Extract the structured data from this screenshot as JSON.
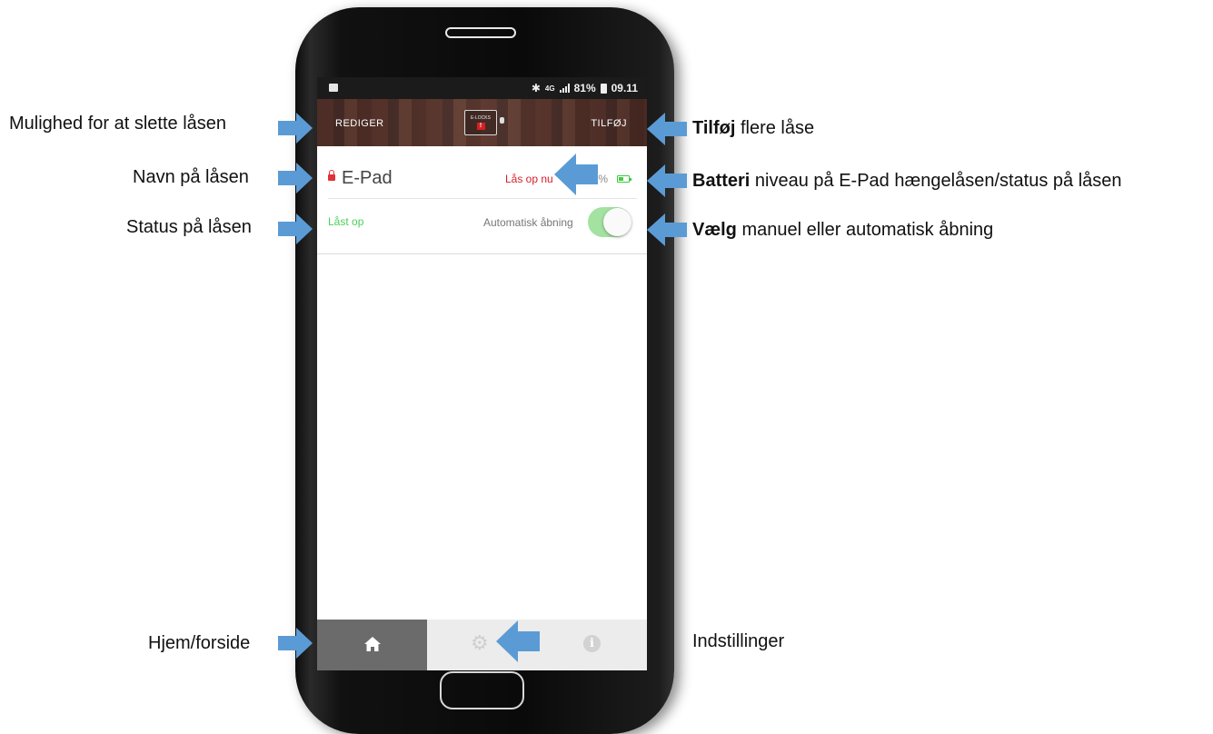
{
  "statusbar": {
    "network": "4G",
    "battery": "81%",
    "time": "09.11"
  },
  "topbar": {
    "edit_label": "REDIGER",
    "add_label": "TILFØJ",
    "logo_text": "E-LOCKS"
  },
  "lock": {
    "name": "E-Pad",
    "action": "Lås op nu",
    "battery_pct": "50%",
    "status": "Låst op",
    "auto_label": "Automatisk åbning",
    "auto_enabled": true
  },
  "nav": {
    "active": "home",
    "items": [
      "home-icon",
      "gear-icon",
      "info-icon"
    ],
    "info_glyph": "i"
  },
  "annotations": {
    "edit": "Mulighed for at slette låsen",
    "name": "Navn på låsen",
    "status": "Status på låsen",
    "home": "Hjem/forside",
    "add_bold": "Tilføj",
    "add_rest": " flere låse",
    "battery_bold": "Batteri",
    "battery_rest": " niveau på E-Pad hængelåsen/status på låsen",
    "auto_bold": "Vælg",
    "auto_rest": " manuel eller automatisk åbning",
    "settings": "Indstillinger"
  },
  "colors": {
    "arrow": "#5b9bd5",
    "lock_red": "#d51f2a",
    "status_green": "#4bd05a",
    "toggle_on": "#a3e2a1"
  }
}
